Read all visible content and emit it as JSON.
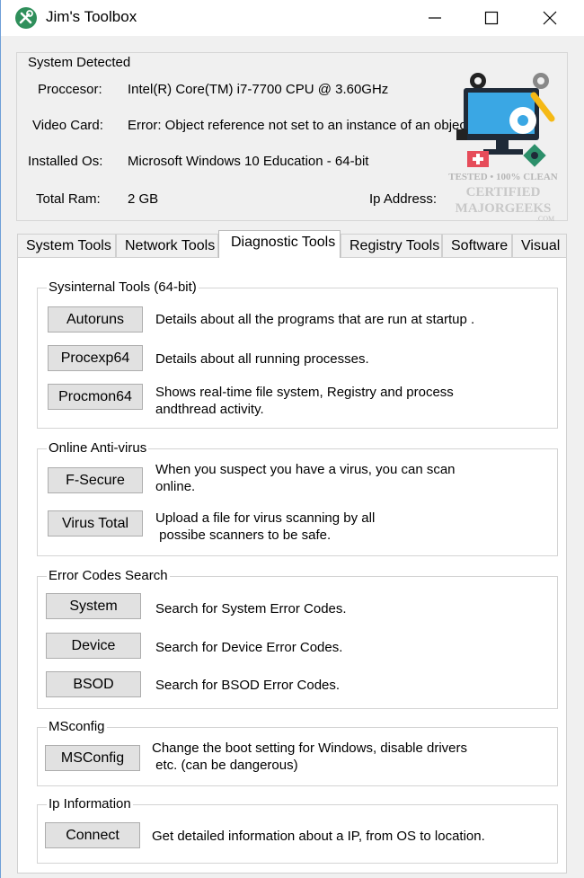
{
  "window": {
    "title": "Jim's Toolbox"
  },
  "system": {
    "legend": "System Detected",
    "processor_label": "Proccesor:",
    "processor_value": "Intel(R) Core(TM) i7-7700 CPU @ 3.60GHz",
    "video_label": "Video Card:",
    "video_value": "Error: Object reference not set to an instance of an object.",
    "os_label": "Installed Os:",
    "os_value": "Microsoft Windows 10 Education - 64-bit",
    "ram_label": "Total Ram:",
    "ram_value": "2 GB",
    "ip_label": "Ip Address:"
  },
  "watermark": {
    "line1": "TESTED • 100% CLEAN",
    "line2": "CERTIFIED",
    "line3": "MAJORGEEKS",
    "line4": ".COM"
  },
  "tabs": [
    "System Tools",
    "Network Tools",
    "Diagnostic Tools",
    "Registry Tools",
    "Software",
    "Visual"
  ],
  "sysinternals": {
    "legend": "Sysinternal Tools (64-bit)",
    "items": [
      {
        "button": "Autoruns",
        "desc": "Details about all the programs that are run at startup ."
      },
      {
        "button": "Procexp64",
        "desc": "Details about all running processes."
      },
      {
        "button": "Procmon64",
        "desc_line1": "Shows real-time file system, Registry and process",
        "desc_line2": "andthread activity."
      }
    ]
  },
  "antivirus": {
    "legend": "Online Anti-virus",
    "items": [
      {
        "button": "F-Secure",
        "desc_line1": "When you suspect you have a virus, you can scan",
        "desc_line2": "online."
      },
      {
        "button": "Virus Total",
        "desc_line1": "Upload a file for virus scanning by all",
        "desc_line2": " possibe scanners to be safe."
      }
    ]
  },
  "errorcodes": {
    "legend": "Error Codes Search",
    "items": [
      {
        "button": "System",
        "desc": "Search for System Error Codes."
      },
      {
        "button": "Device",
        "desc": "Search for Device Error Codes."
      },
      {
        "button": "BSOD",
        "desc": "Search for BSOD Error Codes."
      }
    ]
  },
  "msconfig": {
    "legend": "MSconfig",
    "button": "MSConfig",
    "desc_line1": "Change the boot setting for Windows, disable drivers",
    "desc_line2": " etc. (can be dangerous)"
  },
  "ipinfo": {
    "legend": "Ip Information",
    "button": "Connect",
    "desc": "Get detailed information about a IP, from OS to location."
  }
}
